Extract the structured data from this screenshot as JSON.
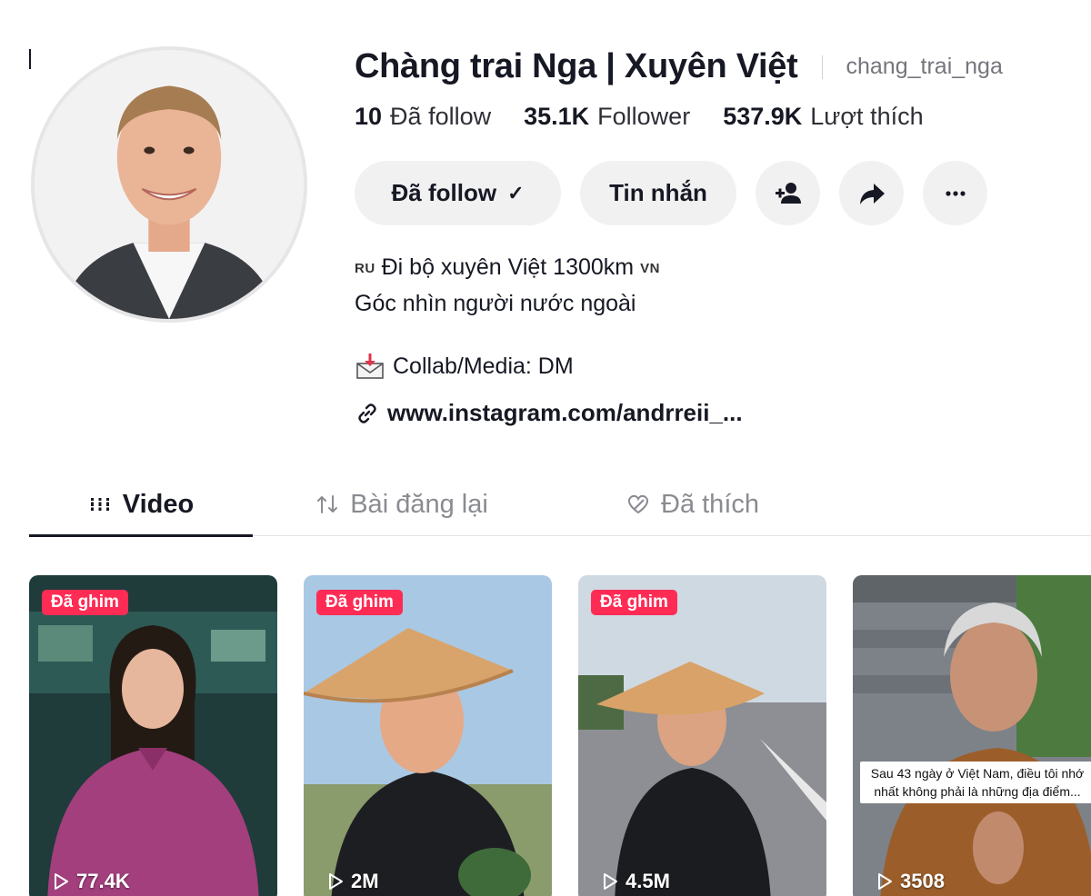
{
  "profile": {
    "display_name": "Chàng trai Nga | Xuyên Việt",
    "username": "chang_trai_nga",
    "stats": [
      {
        "value": "10",
        "label": "Đã follow"
      },
      {
        "value": "35.1K",
        "label": "Follower"
      },
      {
        "value": "537.9K",
        "label": "Lượt thích"
      }
    ],
    "buttons": {
      "follow": "Đã follow",
      "message": "Tin nhắn"
    },
    "bio": {
      "flag_left": "RU",
      "line1": "Đi bộ xuyên Việt 1300km",
      "flag_right": "VN",
      "line2": "Góc nhìn người nước ngoài"
    },
    "collab": "Collab/Media: DM",
    "link": "www.instagram.com/andrreii_..."
  },
  "tabs": [
    {
      "label": "Video",
      "icon": "grid-icon",
      "active": true
    },
    {
      "label": "Bài đăng lại",
      "icon": "repost-icon",
      "active": false
    },
    {
      "label": "Đã thích",
      "icon": "liked-icon",
      "active": false
    }
  ],
  "videos": [
    {
      "pinned_label": "Đã ghim",
      "views": "77.4K"
    },
    {
      "pinned_label": "Đã ghim",
      "views": "2M"
    },
    {
      "pinned_label": "Đã ghim",
      "views": "4.5M"
    },
    {
      "views": "3508",
      "caption": "Sau 43 ngày ở Việt Nam, điều tôi nhớ nhất không phải là những địa điểm..."
    }
  ],
  "colors": {
    "pin_badge": "#fe2c55",
    "button_bg": "#f1f1f2",
    "text": "#161823",
    "muted": "#75767d"
  }
}
